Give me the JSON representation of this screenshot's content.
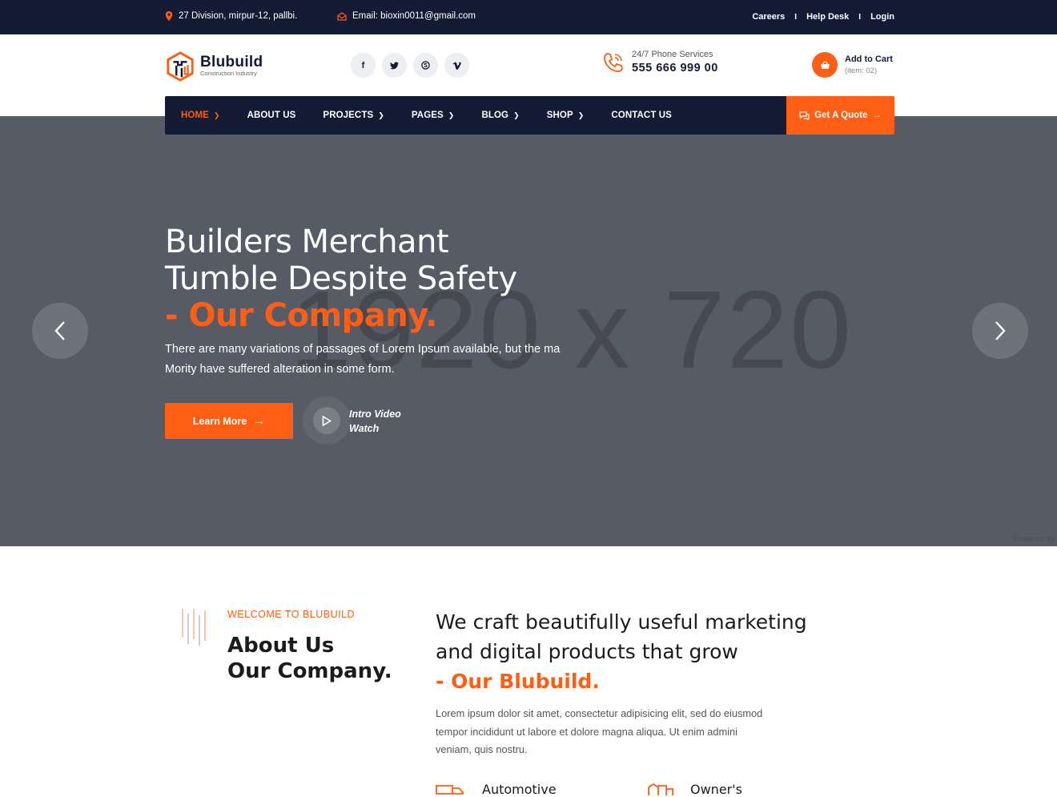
{
  "topbar": {
    "address": "27 Division, mirpur-12, pallbi.",
    "email": "Email: bioxin0011@gmail.com",
    "links": [
      "Careers",
      "Help Desk",
      "Login"
    ],
    "separator": "I"
  },
  "brand": {
    "name": "Blubuild",
    "tagline": "Construction Industry",
    "accent_color": "#ff5e14",
    "dark_color": "#141c35"
  },
  "social": [
    "f",
    "t",
    "s",
    "v"
  ],
  "social_icons": [
    "facebook-icon",
    "twitter-icon",
    "skype-icon",
    "vimeo-icon"
  ],
  "phone": {
    "label": "24/7 Phone Services",
    "number": "555 666 999 00"
  },
  "cart": {
    "label": "Add to Cart",
    "count": "(item: 02)"
  },
  "nav": {
    "items": [
      {
        "label": "HOME",
        "dropdown": true,
        "active": true
      },
      {
        "label": "ABOUT US",
        "dropdown": false
      },
      {
        "label": "PROJECTS",
        "dropdown": true
      },
      {
        "label": "PAGES",
        "dropdown": true
      },
      {
        "label": "BLOG",
        "dropdown": true
      },
      {
        "label": "SHOP",
        "dropdown": true
      },
      {
        "label": "CONTACT US",
        "dropdown": false
      }
    ],
    "quote_label": "Get A Quote"
  },
  "hero": {
    "placeholder": "1920 x 720",
    "line1": "Builders Merchant",
    "line2": "Tumble Despite Safety",
    "highlight": "- Our Company.",
    "text": "There are many variations of passages of Lorem Ipsum available, but the ma Mority have suffered alteration in some form.",
    "button": "Learn More",
    "video_line1": "Intro Video",
    "video_line2": "Watch",
    "powered": "Powered by"
  },
  "about": {
    "eyebrow": "WELCOME TO BLUBUILD",
    "title1": "About Us",
    "title2": "Our Company.",
    "heading1": "We craft beautifully useful marketing",
    "heading2": "and digital products that grow",
    "highlight": "- Our Blubuild.",
    "paragraph": "Lorem ipsum dolor sit amet, consectetur adipisicing elit, sed do eiusmod tempor incididunt ut labore et dolore magna aliqua. Ut enim admini veniam, quis nostru.",
    "features": [
      "Automotive",
      "Owner's"
    ]
  }
}
